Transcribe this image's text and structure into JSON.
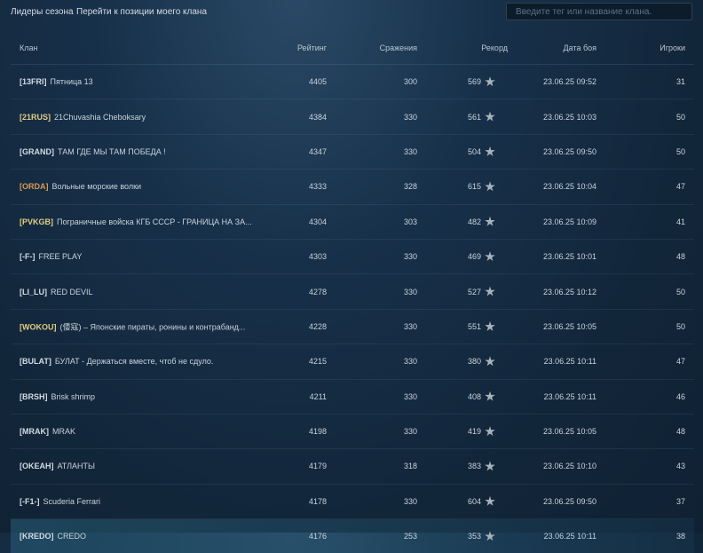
{
  "topbar": {
    "leaders_link": "Лидеры сезона",
    "my_position_link": "Перейти к позиции моего клана",
    "search_placeholder": "Введите тег или название клана."
  },
  "table": {
    "headers": {
      "clan": "Клан",
      "rating": "Рейтинг",
      "battles": "Сражения",
      "record": "Рекорд",
      "date": "Дата боя",
      "players": "Игроки"
    },
    "rows": [
      {
        "tag": "[13FRI]",
        "tag_color": "plain",
        "name": "Пятница 13",
        "rating": "4405",
        "battles": "300",
        "record": "569",
        "date": "23.06.25 09:52",
        "players": "31"
      },
      {
        "tag": "[21RUS]",
        "tag_color": "gold",
        "name": "21Chuvashia Cheboksary",
        "rating": "4384",
        "battles": "330",
        "record": "561",
        "date": "23.06.25 10:03",
        "players": "50"
      },
      {
        "tag": "[GRAND]",
        "tag_color": "plain",
        "name": "ТАМ ГДЕ МЫ ТАМ ПОБЕДА !",
        "rating": "4347",
        "battles": "330",
        "record": "504",
        "date": "23.06.25 09:50",
        "players": "50"
      },
      {
        "tag": "[ORDA]",
        "tag_color": "orange",
        "name": "Вольные морские волки",
        "rating": "4333",
        "battles": "328",
        "record": "615",
        "date": "23.06.25 10:04",
        "players": "47"
      },
      {
        "tag": "[PVKGB]",
        "tag_color": "gold",
        "name": "Пограничные войска КГБ СССР - ГРАНИЦА НА ЗА...",
        "rating": "4304",
        "battles": "303",
        "record": "482",
        "date": "23.06.25 10:09",
        "players": "41"
      },
      {
        "tag": "[-F-]",
        "tag_color": "plain",
        "name": "FREE PLAY",
        "rating": "4303",
        "battles": "330",
        "record": "469",
        "date": "23.06.25 10:01",
        "players": "48"
      },
      {
        "tag": "[LI_LU]",
        "tag_color": "plain",
        "name": "RED DEVIL",
        "rating": "4278",
        "battles": "330",
        "record": "527",
        "date": "23.06.25 10:12",
        "players": "50"
      },
      {
        "tag": "[WOKOU]",
        "tag_color": "gold",
        "name": "(倭寇) – Японские пираты, ронины и контрабанд...",
        "rating": "4228",
        "battles": "330",
        "record": "551",
        "date": "23.06.25 10:05",
        "players": "50"
      },
      {
        "tag": "[BULAT]",
        "tag_color": "plain",
        "name": "БУЛАТ - Держаться вместе, чтоб не сдуло.",
        "rating": "4215",
        "battles": "330",
        "record": "380",
        "date": "23.06.25 10:11",
        "players": "47"
      },
      {
        "tag": "[BRSH]",
        "tag_color": "plain",
        "name": "Brisk shrimp",
        "rating": "4211",
        "battles": "330",
        "record": "408",
        "date": "23.06.25 10:11",
        "players": "46"
      },
      {
        "tag": "[MRAK]",
        "tag_color": "plain",
        "name": "MRAK",
        "rating": "4198",
        "battles": "330",
        "record": "419",
        "date": "23.06.25 10:05",
        "players": "48"
      },
      {
        "tag": "[OKEAH]",
        "tag_color": "plain",
        "name": "АТЛАНТЫ",
        "rating": "4179",
        "battles": "318",
        "record": "383",
        "date": "23.06.25 10:10",
        "players": "43"
      },
      {
        "tag": "[-F1-]",
        "tag_color": "plain",
        "name": "Scuderia Ferrari",
        "rating": "4178",
        "battles": "330",
        "record": "604",
        "date": "23.06.25 09:50",
        "players": "37"
      },
      {
        "tag": "[KREDO]",
        "tag_color": "plain",
        "name": "CREDO",
        "rating": "4176",
        "battles": "253",
        "record": "353",
        "date": "23.06.25 10:11",
        "players": "38",
        "highlight": true
      }
    ]
  },
  "icons": {
    "record": "star-icon"
  },
  "colors": {
    "tag_gold": "#e1cd84",
    "tag_orange": "#d99a52",
    "highlight_row": "#28607a"
  }
}
